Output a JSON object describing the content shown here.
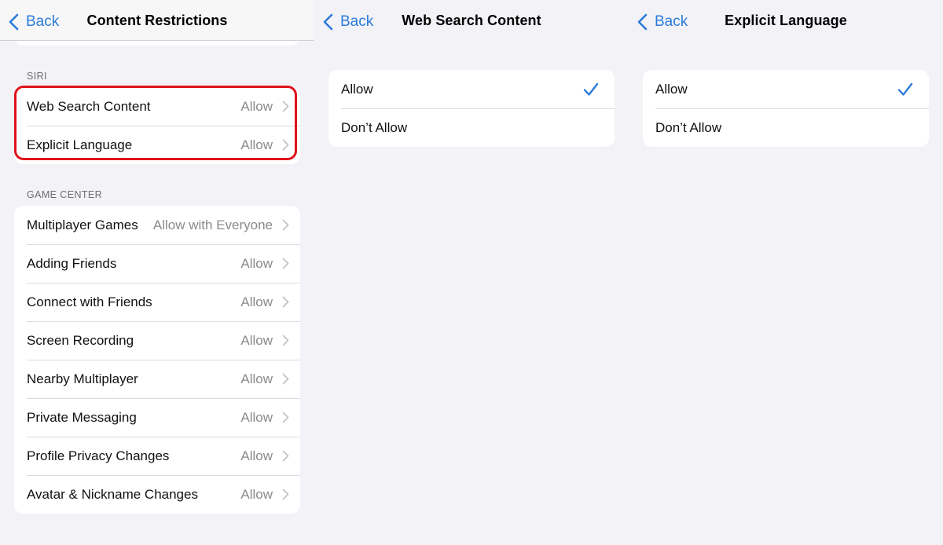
{
  "accent_color": "#2b7bd8",
  "highlight_color": "#e0121c",
  "panel1": {
    "back_label": "Back",
    "title": "Content Restrictions",
    "siri": {
      "header": "SIRI",
      "rows": [
        {
          "label": "Web Search Content",
          "value": "Allow"
        },
        {
          "label": "Explicit Language",
          "value": "Allow"
        }
      ]
    },
    "game_center": {
      "header": "GAME CENTER",
      "rows": [
        {
          "label": "Multiplayer Games",
          "value": "Allow with Everyone"
        },
        {
          "label": "Adding Friends",
          "value": "Allow"
        },
        {
          "label": "Connect with Friends",
          "value": "Allow"
        },
        {
          "label": "Screen Recording",
          "value": "Allow"
        },
        {
          "label": "Nearby Multiplayer",
          "value": "Allow"
        },
        {
          "label": "Private Messaging",
          "value": "Allow"
        },
        {
          "label": "Profile Privacy Changes",
          "value": "Allow"
        },
        {
          "label": "Avatar & Nickname Changes",
          "value": "Allow"
        }
      ]
    }
  },
  "panel2": {
    "back_label": "Back",
    "title": "Web Search Content",
    "options": [
      {
        "label": "Allow",
        "selected": true
      },
      {
        "label": "Don’t Allow",
        "selected": false
      }
    ]
  },
  "panel3": {
    "back_label": "Back",
    "title": "Explicit Language",
    "options": [
      {
        "label": "Allow",
        "selected": true
      },
      {
        "label": "Don’t Allow",
        "selected": false
      }
    ]
  }
}
